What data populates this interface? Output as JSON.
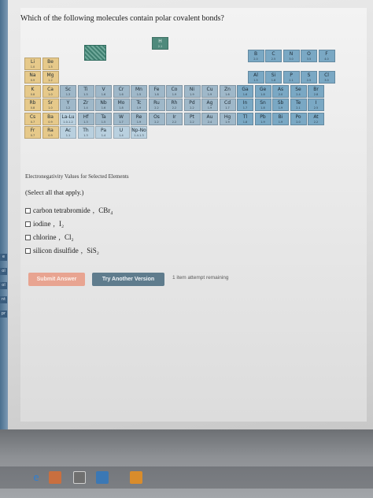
{
  "question": "Which of the following molecules contain polar covalent bonds?",
  "periodic_table": {
    "caption": "Electronegativity Values for Selected Elements",
    "cells": [
      {
        "sym": "H",
        "en": "2.1",
        "col": 7.2,
        "row": 0,
        "type": "h"
      },
      {
        "sym": "Li",
        "en": "1.0",
        "col": 0,
        "row": 1,
        "type": "s"
      },
      {
        "sym": "Be",
        "en": "1.5",
        "col": 1,
        "row": 1,
        "type": "s"
      },
      {
        "sym": "B",
        "en": "2.0",
        "col": 12.6,
        "row": 1,
        "type": "p"
      },
      {
        "sym": "C",
        "en": "2.5",
        "col": 13.6,
        "row": 1,
        "type": "p"
      },
      {
        "sym": "N",
        "en": "3.0",
        "col": 14.6,
        "row": 1,
        "type": "p"
      },
      {
        "sym": "O",
        "en": "3.5",
        "col": 15.6,
        "row": 1,
        "type": "p"
      },
      {
        "sym": "F",
        "en": "4.0",
        "col": 16.6,
        "row": 1,
        "type": "p"
      },
      {
        "sym": "Na",
        "en": "0.9",
        "col": 0,
        "row": 2,
        "type": "s"
      },
      {
        "sym": "Mg",
        "en": "1.2",
        "col": 1,
        "row": 2,
        "type": "s"
      },
      {
        "sym": "Al",
        "en": "1.5",
        "col": 12.6,
        "row": 2,
        "type": "p"
      },
      {
        "sym": "Si",
        "en": "1.8",
        "col": 13.6,
        "row": 2,
        "type": "p"
      },
      {
        "sym": "P",
        "en": "2.1",
        "col": 14.6,
        "row": 2,
        "type": "p"
      },
      {
        "sym": "S",
        "en": "2.5",
        "col": 15.6,
        "row": 2,
        "type": "p"
      },
      {
        "sym": "Cl",
        "en": "3.0",
        "col": 16.6,
        "row": 2,
        "type": "p"
      },
      {
        "sym": "K",
        "en": "0.8",
        "col": 0,
        "row": 3,
        "type": "s"
      },
      {
        "sym": "Ca",
        "en": "1.0",
        "col": 1,
        "row": 3,
        "type": "s"
      },
      {
        "sym": "Sc",
        "en": "1.3",
        "col": 2,
        "row": 3,
        "type": "d"
      },
      {
        "sym": "Ti",
        "en": "1.5",
        "col": 3,
        "row": 3,
        "type": "d"
      },
      {
        "sym": "V",
        "en": "1.6",
        "col": 4,
        "row": 3,
        "type": "d"
      },
      {
        "sym": "Cr",
        "en": "1.6",
        "col": 5,
        "row": 3,
        "type": "d"
      },
      {
        "sym": "Mn",
        "en": "1.5",
        "col": 6,
        "row": 3,
        "type": "d"
      },
      {
        "sym": "Fe",
        "en": "1.8",
        "col": 7,
        "row": 3,
        "type": "d"
      },
      {
        "sym": "Co",
        "en": "1.9",
        "col": 8,
        "row": 3,
        "type": "d"
      },
      {
        "sym": "Ni",
        "en": "1.9",
        "col": 9,
        "row": 3,
        "type": "d"
      },
      {
        "sym": "Cu",
        "en": "1.9",
        "col": 10,
        "row": 3,
        "type": "d"
      },
      {
        "sym": "Zn",
        "en": "1.6",
        "col": 11,
        "row": 3,
        "type": "d"
      },
      {
        "sym": "Ga",
        "en": "1.6",
        "col": 12,
        "row": 3,
        "type": "p"
      },
      {
        "sym": "Ge",
        "en": "1.8",
        "col": 13,
        "row": 3,
        "type": "p"
      },
      {
        "sym": "As",
        "en": "2.0",
        "col": 14,
        "row": 3,
        "type": "p"
      },
      {
        "sym": "Se",
        "en": "2.4",
        "col": 15,
        "row": 3,
        "type": "p"
      },
      {
        "sym": "Br",
        "en": "2.8",
        "col": 16,
        "row": 3,
        "type": "p"
      },
      {
        "sym": "Rb",
        "en": "0.8",
        "col": 0,
        "row": 4,
        "type": "s"
      },
      {
        "sym": "Sr",
        "en": "1.0",
        "col": 1,
        "row": 4,
        "type": "s"
      },
      {
        "sym": "Y",
        "en": "1.2",
        "col": 2,
        "row": 4,
        "type": "d"
      },
      {
        "sym": "Zr",
        "en": "1.4",
        "col": 3,
        "row": 4,
        "type": "d"
      },
      {
        "sym": "Nb",
        "en": "1.6",
        "col": 4,
        "row": 4,
        "type": "d"
      },
      {
        "sym": "Mo",
        "en": "1.8",
        "col": 5,
        "row": 4,
        "type": "d"
      },
      {
        "sym": "Tc",
        "en": "1.9",
        "col": 6,
        "row": 4,
        "type": "d"
      },
      {
        "sym": "Ru",
        "en": "2.2",
        "col": 7,
        "row": 4,
        "type": "d"
      },
      {
        "sym": "Rh",
        "en": "2.2",
        "col": 8,
        "row": 4,
        "type": "d"
      },
      {
        "sym": "Pd",
        "en": "2.2",
        "col": 9,
        "row": 4,
        "type": "d"
      },
      {
        "sym": "Ag",
        "en": "1.9",
        "col": 10,
        "row": 4,
        "type": "d"
      },
      {
        "sym": "Cd",
        "en": "1.7",
        "col": 11,
        "row": 4,
        "type": "d"
      },
      {
        "sym": "In",
        "en": "1.7",
        "col": 12,
        "row": 4,
        "type": "p"
      },
      {
        "sym": "Sn",
        "en": "1.8",
        "col": 13,
        "row": 4,
        "type": "p"
      },
      {
        "sym": "Sb",
        "en": "1.9",
        "col": 14,
        "row": 4,
        "type": "p"
      },
      {
        "sym": "Te",
        "en": "2.1",
        "col": 15,
        "row": 4,
        "type": "p"
      },
      {
        "sym": "I",
        "en": "2.5",
        "col": 16,
        "row": 4,
        "type": "p"
      },
      {
        "sym": "Cs",
        "en": "0.7",
        "col": 0,
        "row": 5,
        "type": "s"
      },
      {
        "sym": "Ba",
        "en": "0.9",
        "col": 1,
        "row": 5,
        "type": "s"
      },
      {
        "sym": "La-Lu",
        "en": "1.0-1.2",
        "col": 2,
        "row": 5,
        "type": "l"
      },
      {
        "sym": "Hf",
        "en": "1.3",
        "col": 3,
        "row": 5,
        "type": "d"
      },
      {
        "sym": "Ta",
        "en": "1.5",
        "col": 4,
        "row": 5,
        "type": "d"
      },
      {
        "sym": "W",
        "en": "1.7",
        "col": 5,
        "row": 5,
        "type": "d"
      },
      {
        "sym": "Re",
        "en": "1.9",
        "col": 6,
        "row": 5,
        "type": "d"
      },
      {
        "sym": "Os",
        "en": "2.2",
        "col": 7,
        "row": 5,
        "type": "d"
      },
      {
        "sym": "Ir",
        "en": "2.2",
        "col": 8,
        "row": 5,
        "type": "d"
      },
      {
        "sym": "Pt",
        "en": "2.2",
        "col": 9,
        "row": 5,
        "type": "d"
      },
      {
        "sym": "Au",
        "en": "2.4",
        "col": 10,
        "row": 5,
        "type": "d"
      },
      {
        "sym": "Hg",
        "en": "1.9",
        "col": 11,
        "row": 5,
        "type": "d"
      },
      {
        "sym": "Tl",
        "en": "1.8",
        "col": 12,
        "row": 5,
        "type": "p"
      },
      {
        "sym": "Pb",
        "en": "1.9",
        "col": 13,
        "row": 5,
        "type": "p"
      },
      {
        "sym": "Bi",
        "en": "1.9",
        "col": 14,
        "row": 5,
        "type": "p"
      },
      {
        "sym": "Po",
        "en": "2.0",
        "col": 15,
        "row": 5,
        "type": "p"
      },
      {
        "sym": "At",
        "en": "2.2",
        "col": 16,
        "row": 5,
        "type": "p"
      },
      {
        "sym": "Fr",
        "en": "0.7",
        "col": 0,
        "row": 6,
        "type": "s"
      },
      {
        "sym": "Ra",
        "en": "0.9",
        "col": 1,
        "row": 6,
        "type": "s"
      },
      {
        "sym": "Ac",
        "en": "1.1",
        "col": 2,
        "row": 6,
        "type": "l"
      },
      {
        "sym": "Th",
        "en": "1.3",
        "col": 3,
        "row": 6,
        "type": "l"
      },
      {
        "sym": "Pa",
        "en": "1.4",
        "col": 4,
        "row": 6,
        "type": "l"
      },
      {
        "sym": "U",
        "en": "1.4",
        "col": 5,
        "row": 6,
        "type": "l"
      },
      {
        "sym": "Np-No",
        "en": "1.4-1.3",
        "col": 6,
        "row": 6,
        "type": "l"
      }
    ]
  },
  "instruction": "(Select all that apply.)",
  "options": [
    {
      "name": "carbon tetrabromide",
      "formula": "CBr₄"
    },
    {
      "name": "iodine",
      "formula": "I₂"
    },
    {
      "name": "chlorine",
      "formula": "Cl₂"
    },
    {
      "name": "silicon disulfide",
      "formula": "SiS₂"
    }
  ],
  "buttons": {
    "submit": "Submit Answer",
    "try_another": "Try Another Version"
  },
  "attempts_text": "1 item attempt remaining",
  "left_strip_labels": [
    "e",
    "ol",
    "ol",
    "nt",
    "pr"
  ],
  "taskbar_icons": [
    "edge-icon",
    "store-icon",
    "app-icon",
    "app-icon",
    "app-icon"
  ],
  "colors": {
    "s_block": "#e6c98a",
    "d_block": "#9fb8c9",
    "p_block": "#7aa8c4",
    "hydrogen": "#4f8a7c",
    "submit_button": "#e8a491",
    "try_button": "#5f7c8d"
  }
}
